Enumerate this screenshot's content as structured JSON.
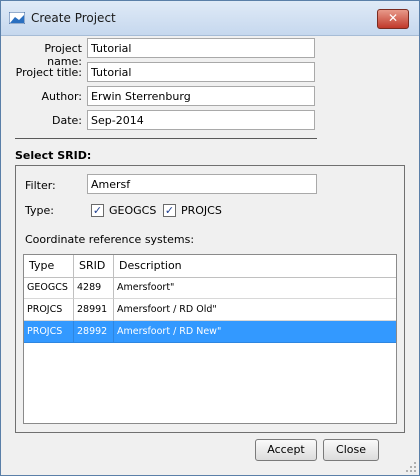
{
  "window": {
    "title": "Create Project",
    "close_glyph": "✕"
  },
  "project": {
    "name_label": "Project name:",
    "name_value": "Tutorial",
    "title_label": "Project title:",
    "title_value": "Tutorial",
    "author_label": "Author:",
    "author_value": "Erwin Sterrenburg",
    "date_label": "Date:",
    "date_value": "Sep-2014"
  },
  "srid": {
    "section_title": "Select SRID:",
    "filter_label": "Filter:",
    "filter_value": "Amersf",
    "type_label": "Type:",
    "geogcs_label": "GEOGCS",
    "geogcs_checked": true,
    "projcs_label": "PROJCS",
    "projcs_checked": true,
    "check_glyph": "✓",
    "crs_label": "Coordinate reference systems:",
    "columns": [
      "Type",
      "SRID",
      "Description"
    ],
    "rows": [
      {
        "type": "GEOGCS",
        "srid": "4289",
        "description": "Amersfoort\""
      },
      {
        "type": "PROJCS",
        "srid": "28991",
        "description": "Amersfoort / RD Old\""
      },
      {
        "type": "PROJCS",
        "srid": "28992",
        "description": "Amersfoort / RD New\""
      }
    ],
    "selected_row": 2
  },
  "buttons": {
    "accept": "Accept",
    "close": "Close"
  },
  "icons": {
    "app": "app-icon",
    "close": "close-icon",
    "resize": "resize-grip-icon"
  },
  "colors": {
    "selection": "#3399ff",
    "titlebar": "#c6d8ee"
  }
}
